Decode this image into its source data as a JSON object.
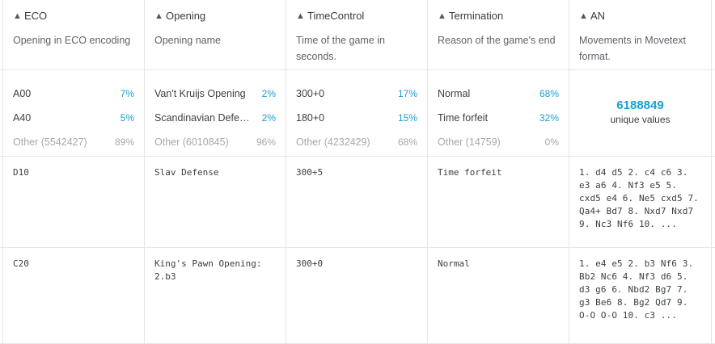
{
  "columns": [
    {
      "name": "ECO",
      "icon": "sort-icon",
      "description": "Opening in ECO encoding"
    },
    {
      "name": "Opening",
      "icon": "sort-icon",
      "description": "Opening name"
    },
    {
      "name": "TimeControl",
      "icon": "sort-icon",
      "description": "Time of the game in seconds."
    },
    {
      "name": "Termination",
      "icon": "sort-icon",
      "description": "Reason of the game's end"
    },
    {
      "name": "AN",
      "icon": "sort-icon",
      "description": "Movements in Movetext format."
    }
  ],
  "stats": {
    "eco": [
      {
        "label": "A00",
        "pct": "7%"
      },
      {
        "label": "A40",
        "pct": "5%"
      },
      {
        "label": "Other (5542427)",
        "pct": "89%"
      }
    ],
    "opening": [
      {
        "label": "Van't Kruijs Opening",
        "pct": "2%"
      },
      {
        "label": "Scandinavian Defen...",
        "pct": "2%"
      },
      {
        "label": "Other (6010845)",
        "pct": "96%"
      }
    ],
    "timecontrol": [
      {
        "label": "300+0",
        "pct": "17%"
      },
      {
        "label": "180+0",
        "pct": "15%"
      },
      {
        "label": "Other (4232429)",
        "pct": "68%"
      }
    ],
    "termination": [
      {
        "label": "Normal",
        "pct": "68%"
      },
      {
        "label": "Time forfeit",
        "pct": "32%"
      },
      {
        "label": "Other (14759)",
        "pct": "0%"
      }
    ],
    "an": {
      "unique_count": "6188849",
      "unique_label": "unique values"
    }
  },
  "rows": [
    {
      "eco": "D10",
      "opening": "Slav Defense",
      "timecontrol": "300+5",
      "termination": "Time forfeit",
      "an": "1. d4 d5 2. c4 c6 3. e3 a6 4. Nf3 e5 5. cxd5 e4 6. Ne5 cxd5 7. Qa4+ Bd7 8. Nxd7 Nxd7 9. Nc3 Nf6 10. ..."
    },
    {
      "eco": "C20",
      "opening": "King's Pawn Opening: 2.b3",
      "timecontrol": "300+0",
      "termination": "Normal",
      "an": "1. e4 e5 2. b3 Nf6 3. Bb2 Nc6 4. Nf3 d6 5. d3 g6 6. Nbd2 Bg7 7. g3 Be6 8. Bg2 Qd7 9. O-O O-O 10. c3 ..."
    }
  ],
  "colors": {
    "accent": "#1a9ed1",
    "muted": "#a4a8ad",
    "border": "#e6e6e6"
  }
}
